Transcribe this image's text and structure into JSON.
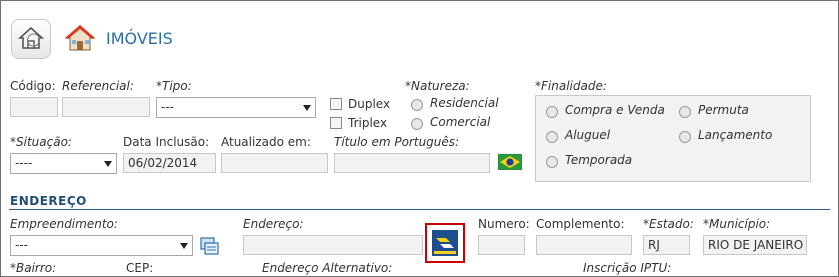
{
  "header": {
    "title": "IMÓVEIS",
    "home_icon": "home-icon",
    "house_icon": "house-icon"
  },
  "labels": {
    "codigo": "Código:",
    "referencial": "Referencial:",
    "tipo": "*Tipo:",
    "natureza": "*Natureza:",
    "finalidade": "*Finalidade:",
    "situacao": "*Situação:",
    "data_inclusao": "Data Inclusão:",
    "atualizado_em": "Atualizado em:",
    "titulo_pt": "Título em Português:",
    "endereco_section": "ENDEREÇO",
    "empreendimento": "Empreendimento:",
    "endereco": "Endereço:",
    "numero": "Numero:",
    "complemento": "Complemento:",
    "estado": "*Estado:",
    "municipio": "*Município:",
    "bairro": "*Bairro:",
    "cep": "CEP:",
    "endereco_alternativo": "Endereço Alternativo:",
    "inscricao_iptu": "Inscrição IPTU:"
  },
  "fields": {
    "codigo": "",
    "referencial": "",
    "tipo_selected": "---",
    "situacao_selected": "----",
    "data_inclusao": "06/02/2014",
    "atualizado_em": "",
    "titulo_pt": "",
    "empreendimento_selected": "---",
    "endereco": "",
    "numero": "",
    "complemento": "",
    "estado": "RJ",
    "municipio": "RIO DE JANEIRO"
  },
  "checkboxes": {
    "duplex": "Duplex",
    "triplex": "Triplex"
  },
  "natureza_options": [
    "Residencial",
    "Comercial"
  ],
  "finalidade_options": [
    "Compra e Venda",
    "Permuta",
    "Aluguel",
    "Lançamento",
    "Temporada"
  ],
  "colors": {
    "accent": "#2e5c8a",
    "highlight": "#cc0000"
  }
}
